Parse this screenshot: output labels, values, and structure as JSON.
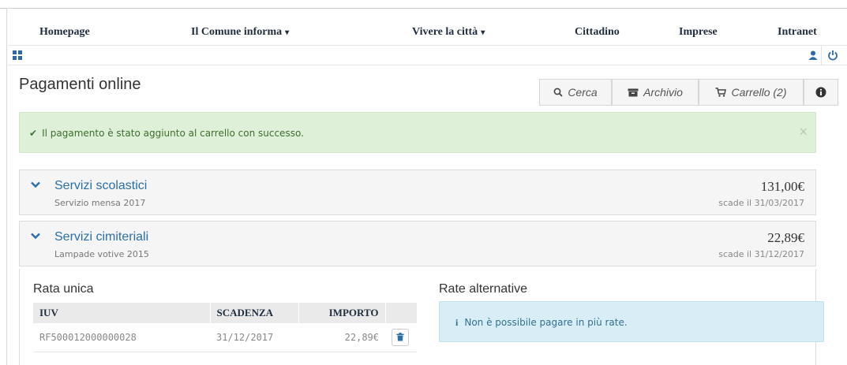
{
  "nav": {
    "items": [
      {
        "label": "Homepage",
        "caret": ""
      },
      {
        "label": "Il Comune informa",
        "caret": "▾"
      },
      {
        "label": "Vivere la città",
        "caret": "▾"
      },
      {
        "label": "Cittadino",
        "caret": ""
      },
      {
        "label": "Imprese",
        "caret": ""
      },
      {
        "label": "Intranet",
        "caret": ""
      }
    ]
  },
  "toolbar": {
    "grid_icon": "grid-icon",
    "user_icon": "user-icon",
    "power_icon": "power-icon"
  },
  "page": {
    "title": "Pagamenti online"
  },
  "actions": {
    "search_label": "Cerca",
    "archive_label": "Archivio",
    "cart_label": "Carrello (2)"
  },
  "alert_success": {
    "message": "Il pagamento è stato aggiunto al carrello con successo.",
    "close": "×"
  },
  "panels": [
    {
      "title": "Servizi scolastici",
      "subtitle": "Servizio mensa 2017",
      "amount": "131,00€",
      "due": "scade il 31/03/2017"
    },
    {
      "title": "Servizi cimiteriali",
      "subtitle": "Lampade votive 2015",
      "amount": "22,89€",
      "due": "scade il 31/12/2017"
    }
  ],
  "rata_unica": {
    "title": "Rata unica",
    "columns": [
      "IUV",
      "SCADENZA",
      "IMPORTO"
    ],
    "rows": [
      {
        "iuv": "RF500012000000028",
        "scadenza": "31/12/2017",
        "importo": "22,89€"
      }
    ]
  },
  "rate_alternative": {
    "title": "Rate alternative",
    "info_icon": "i",
    "message": "Non è possibile pagare in più rate."
  },
  "colors": {
    "accent": "#2a6fa8",
    "success_bg": "#dff0d8",
    "info_bg": "#d9edf7"
  }
}
